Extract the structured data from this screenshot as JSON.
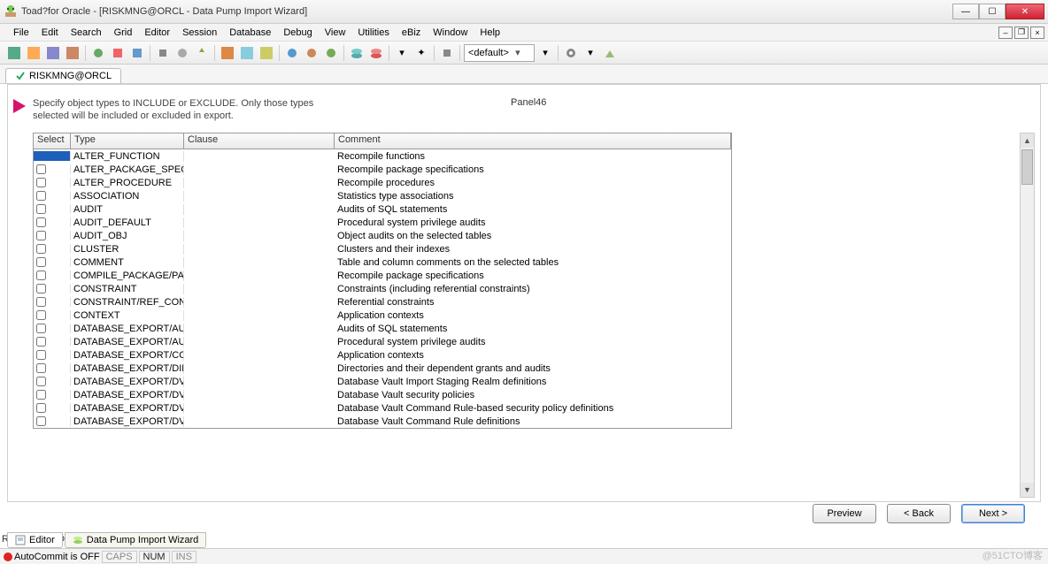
{
  "window": {
    "title": "Toad?for Oracle - [RISKMNG@ORCL - Data Pump Import Wizard]"
  },
  "menu": [
    "File",
    "Edit",
    "Search",
    "Grid",
    "Editor",
    "Session",
    "Database",
    "Debug",
    "View",
    "Utilities",
    "eBiz",
    "Window",
    "Help"
  ],
  "toolbar": {
    "combo_default": "<default>"
  },
  "connection": "RISKMNG@ORCL",
  "wizard": {
    "instruction": "Specify object types to INCLUDE or EXCLUDE.  Only those types selected will be included or excluded in export.",
    "panel_name": "Panel46",
    "columns": {
      "select": "Select",
      "type": "Type",
      "clause": "Clause",
      "comment": "Comment"
    },
    "rows": [
      {
        "selected": true,
        "type": "ALTER_FUNCTION",
        "clause": "",
        "comment": "Recompile functions"
      },
      {
        "selected": false,
        "type": "ALTER_PACKAGE_SPEC",
        "clause": "",
        "comment": "Recompile package specifications"
      },
      {
        "selected": false,
        "type": "ALTER_PROCEDURE",
        "clause": "",
        "comment": "Recompile procedures"
      },
      {
        "selected": false,
        "type": "ASSOCIATION",
        "clause": "",
        "comment": "Statistics type associations"
      },
      {
        "selected": false,
        "type": "AUDIT",
        "clause": "",
        "comment": "Audits of SQL statements"
      },
      {
        "selected": false,
        "type": "AUDIT_DEFAULT",
        "clause": "",
        "comment": "Procedural system privilege audits"
      },
      {
        "selected": false,
        "type": "AUDIT_OBJ",
        "clause": "",
        "comment": "Object audits on the selected tables"
      },
      {
        "selected": false,
        "type": "CLUSTER",
        "clause": "",
        "comment": "Clusters and their indexes"
      },
      {
        "selected": false,
        "type": "COMMENT",
        "clause": "",
        "comment": "Table and column comments on the selected tables"
      },
      {
        "selected": false,
        "type": "COMPILE_PACKAGE/PACKA(",
        "clause": "",
        "comment": "Recompile package specifications"
      },
      {
        "selected": false,
        "type": "CONSTRAINT",
        "clause": "",
        "comment": "Constraints (including referential constraints)"
      },
      {
        "selected": false,
        "type": "CONSTRAINT/REF_CONSTR",
        "clause": "",
        "comment": "Referential constraints"
      },
      {
        "selected": false,
        "type": "CONTEXT",
        "clause": "",
        "comment": "Application contexts"
      },
      {
        "selected": false,
        "type": "DATABASE_EXPORT/AUDIT",
        "clause": "",
        "comment": "Audits of SQL statements"
      },
      {
        "selected": false,
        "type": "DATABASE_EXPORT/AUDIT_",
        "clause": "",
        "comment": "Procedural system privilege audits"
      },
      {
        "selected": false,
        "type": "DATABASE_EXPORT/CONTE",
        "clause": "",
        "comment": "Application contexts"
      },
      {
        "selected": false,
        "type": "DATABASE_EXPORT/DIREC",
        "clause": "",
        "comment": "Directories and their dependent grants and audits"
      },
      {
        "selected": false,
        "type": "DATABASE_EXPORT/DVPS_I",
        "clause": "",
        "comment": "Database Vault Import Staging Realm definitions"
      },
      {
        "selected": false,
        "type": "DATABASE_EXPORT/DVPS_F",
        "clause": "",
        "comment": "Database Vault security policies"
      },
      {
        "selected": false,
        "type": "DATABASE_EXPORT/DVPS_F",
        "clause": "",
        "comment": "Database Vault Command Rule-based security policy definitions"
      },
      {
        "selected": false,
        "type": "DATABASE_EXPORT/DVPS_F",
        "clause": "",
        "comment": "Database Vault Command Rule definitions"
      }
    ],
    "buttons": {
      "preview": "Preview",
      "back": "< Back",
      "next": "Next >"
    }
  },
  "bottom_tabs": {
    "editor": "Editor",
    "wizard": "Data Pump Import Wizard"
  },
  "status": {
    "autocommit": "AutoCommit is OFF",
    "caps": "CAPS",
    "num": "NUM",
    "ins": "INS"
  },
  "watermark": "@51CTO博客"
}
